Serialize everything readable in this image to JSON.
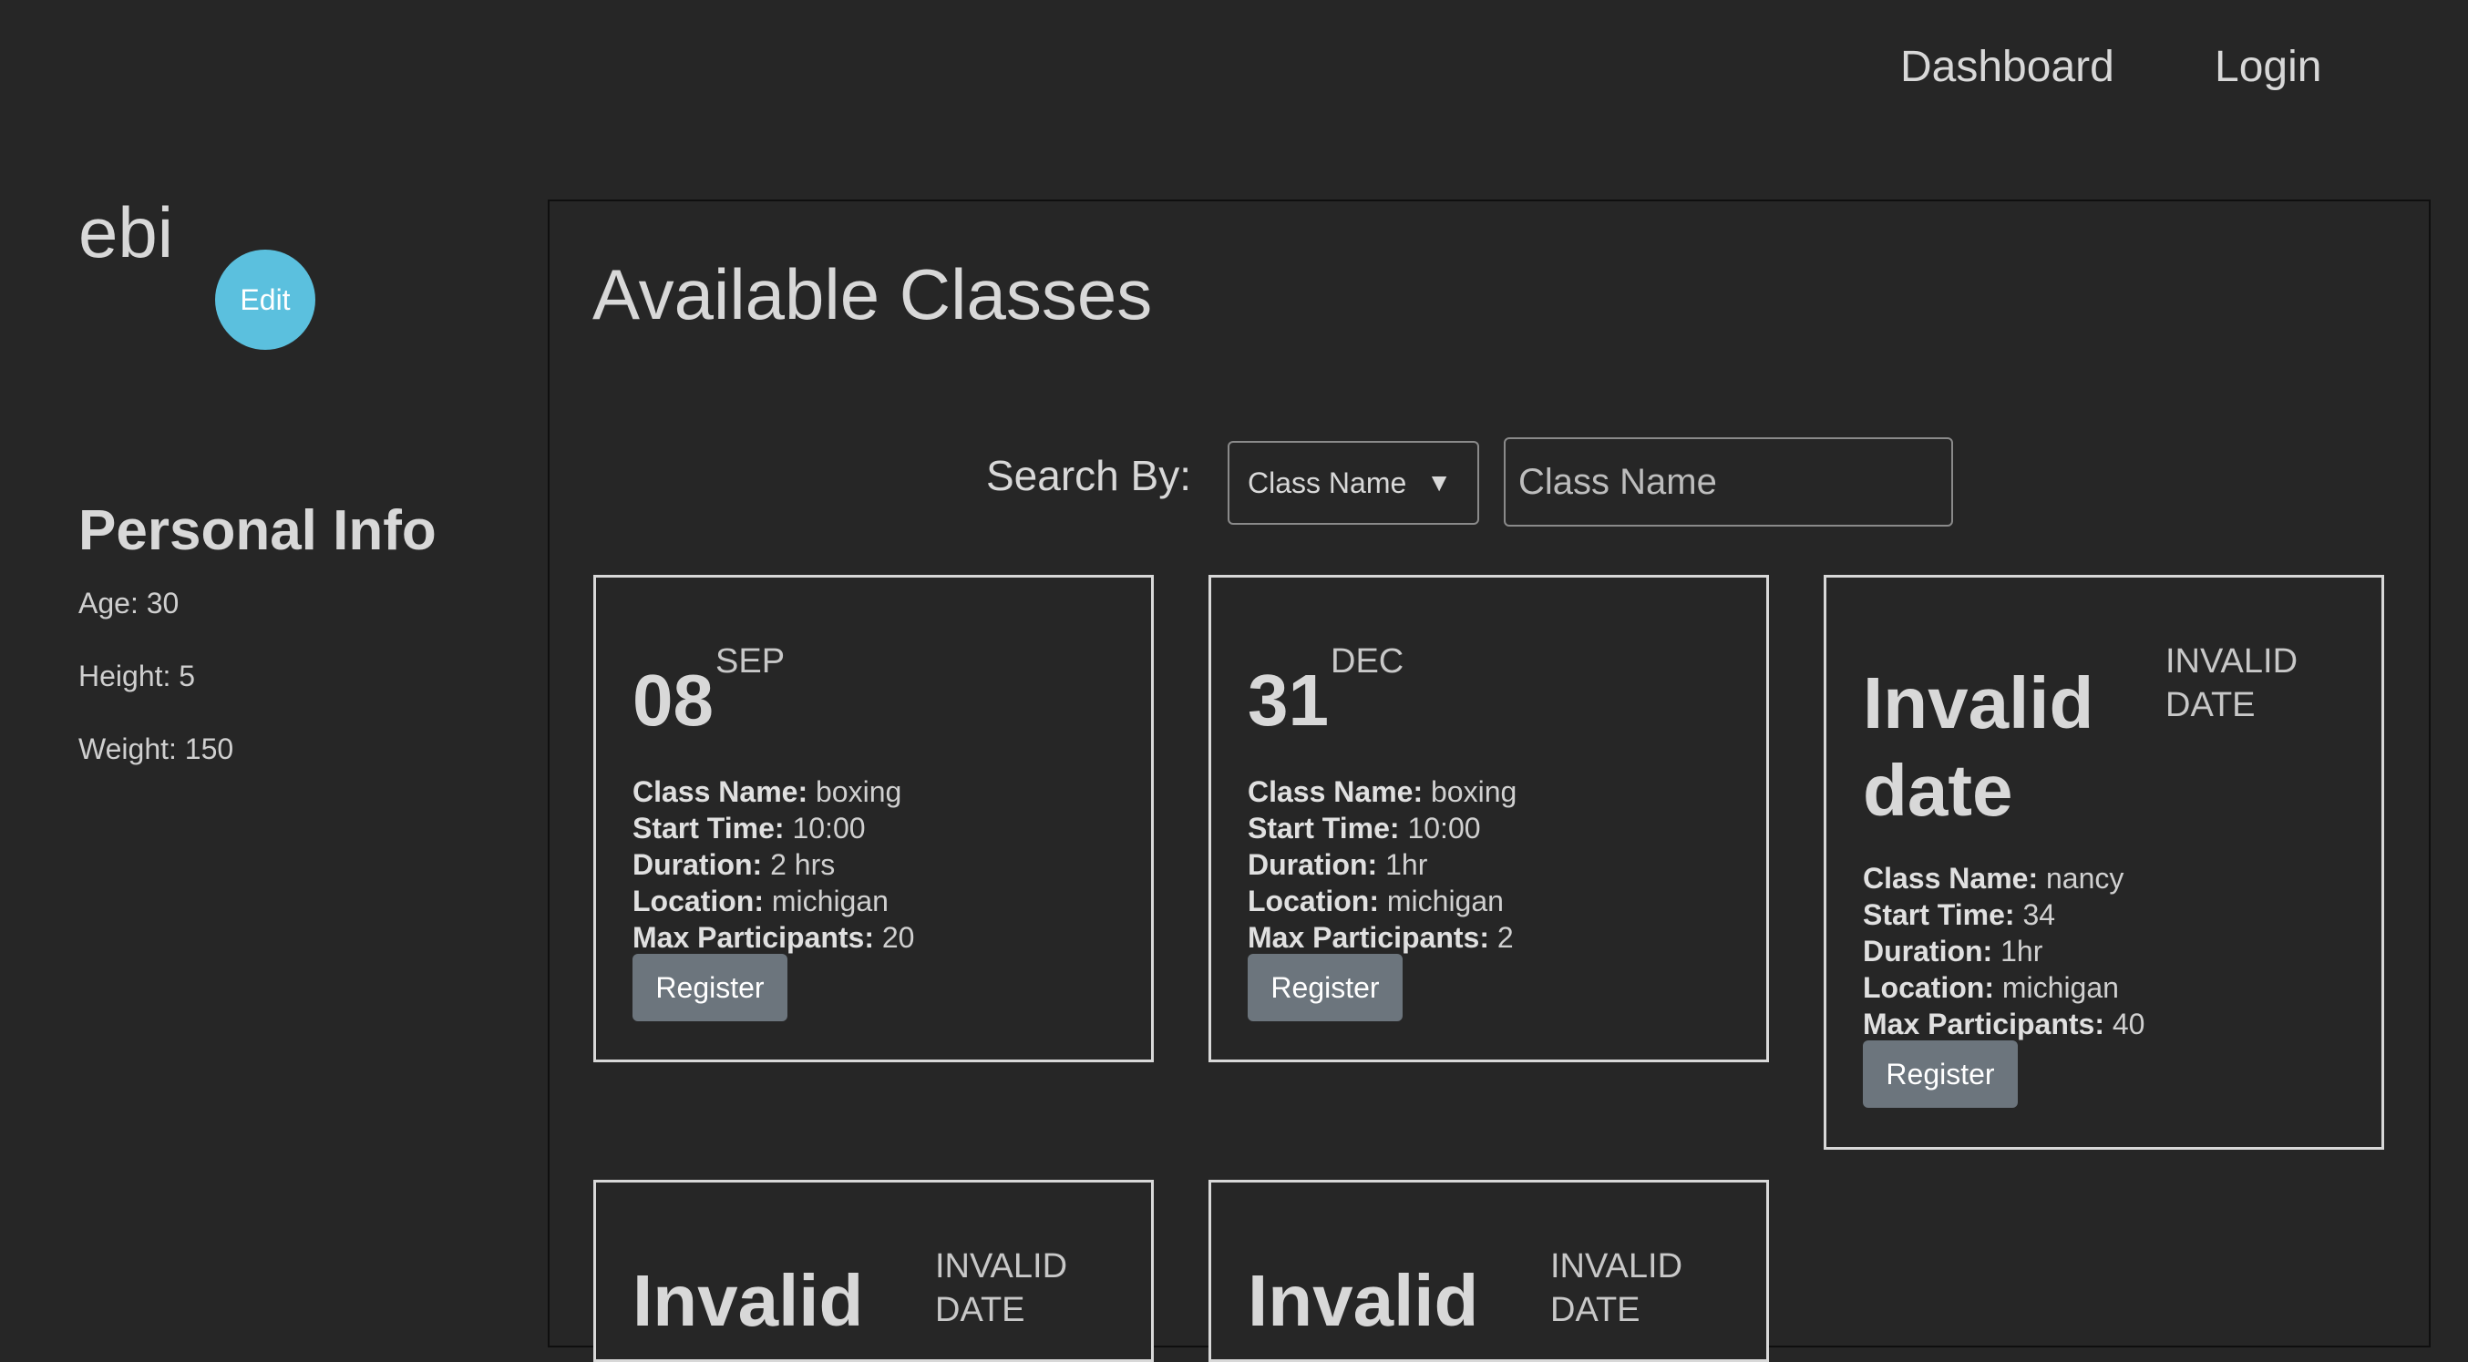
{
  "nav": {
    "dashboard": "Dashboard",
    "login": "Login"
  },
  "sidebar": {
    "username": "ebi",
    "edit_label": "Edit",
    "personal_title": "Personal Info",
    "age": "Age: 30",
    "height": "Height: 5",
    "weight": "Weight: 150"
  },
  "main": {
    "title": "Available Classes",
    "search_label": "Search By:",
    "search_select": "Class Name",
    "search_placeholder": "Class Name"
  },
  "labels": {
    "class_name": "Class Name:",
    "start_time": "Start Time:",
    "duration": "Duration:",
    "location": "Location:",
    "max_participants": "Max Participants:",
    "register": "Register"
  },
  "cards": [
    {
      "day": "08",
      "month": "SEP",
      "class_name": "boxing",
      "start_time": "10:00",
      "duration": "2 hrs",
      "location": "michigan",
      "max_participants": "20"
    },
    {
      "day": "31",
      "month": "DEC",
      "class_name": "boxing",
      "start_time": "10:00",
      "duration": "1hr",
      "location": "michigan",
      "max_participants": "2"
    },
    {
      "day": "Invalid date",
      "month": "INVALID DATE",
      "class_name": "nancy",
      "start_time": "34",
      "duration": "1hr",
      "location": "michigan",
      "max_participants": "40"
    },
    {
      "day": "Invalid",
      "month": "INVALID DATE"
    },
    {
      "day": "Invalid",
      "month": "INVALID DATE"
    }
  ]
}
